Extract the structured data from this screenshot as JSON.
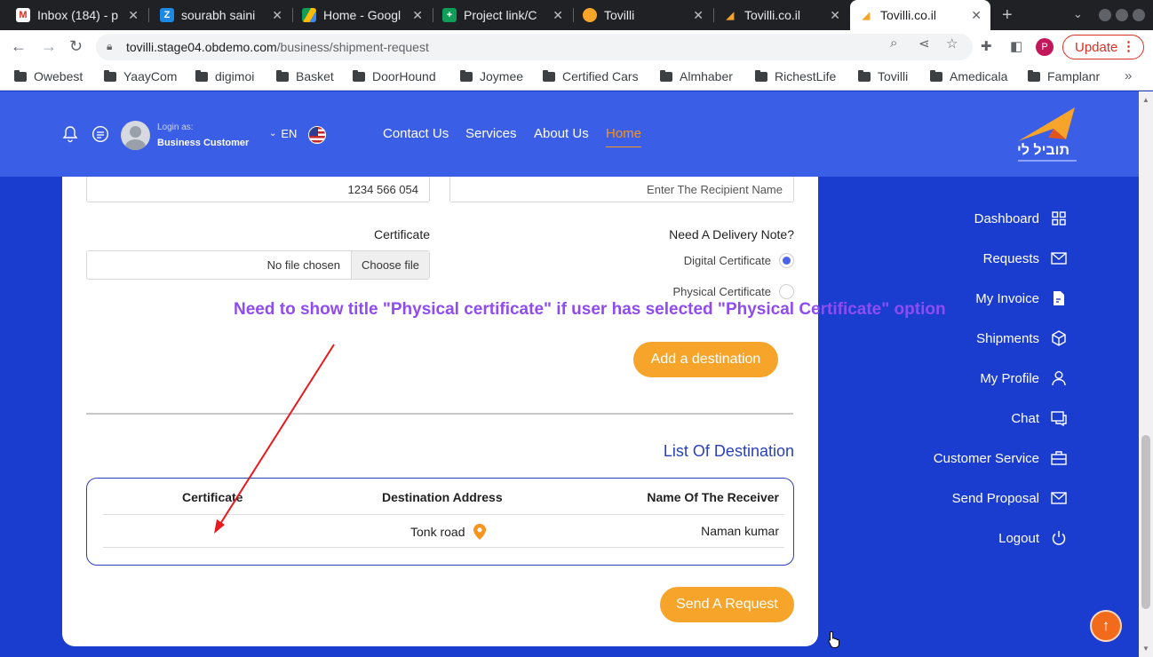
{
  "browser": {
    "tabs": [
      {
        "title": "Inbox (184) - p",
        "favicon": "gmail-icon"
      },
      {
        "title": "sourabh saini",
        "favicon": "zoho-icon"
      },
      {
        "title": "Home - Googl",
        "favicon": "google-drive-icon"
      },
      {
        "title": "Project link/C",
        "favicon": "google-sheets-icon"
      },
      {
        "title": "Tovilli",
        "favicon": "tovilli-icon"
      },
      {
        "title": "Tovilli.co.il",
        "favicon": "tovilli-logo-icon"
      },
      {
        "title": "Tovilli.co.il",
        "favicon": "tovilli-logo-icon",
        "active": true
      }
    ],
    "url_host": "tovilli.stage04.obdemo.com",
    "url_path": "/business/shipment-request",
    "profile_initial": "P",
    "update_label": "Update",
    "bookmarks": [
      "Owebest",
      "YaayCom",
      "digimoi",
      "Basket",
      "DoorHound",
      "Joymee",
      "Certified Cars",
      "Almhaber",
      "RichestLife",
      "Tovilli",
      "Amedicala",
      "Famplanr"
    ]
  },
  "header": {
    "login_as": "Login as:",
    "user_type": "Business Customer",
    "language": "EN",
    "nav": [
      "Contact Us",
      "Services",
      "About Us",
      "Home"
    ],
    "active_nav": "Home",
    "logo_text": "תוביל לי"
  },
  "form": {
    "phone_value": "1234 566 054",
    "recipient_placeholder": "Enter The Recipient Name",
    "certificate_label": "Certificate",
    "file_status": "No file chosen",
    "choose_file_label": "Choose file",
    "delivery_note_label": "Need A Delivery Note?",
    "delivery_options": [
      {
        "label": "Digital Certificate",
        "checked": true
      },
      {
        "label": "Physical Certificate",
        "checked": false
      }
    ],
    "add_destination_label": "Add a destination"
  },
  "destinations": {
    "title": "List Of Destination",
    "columns": [
      "Certificate",
      "Destination Address",
      "Name Of The Receiver"
    ],
    "rows": [
      {
        "certificate": "",
        "address": "Tonk road",
        "receiver": "Naman kumar"
      }
    ]
  },
  "send_request_label": "Send A Request",
  "sidebar": {
    "items": [
      {
        "label": "Dashboard",
        "icon": "grid-icon"
      },
      {
        "label": "Requests",
        "icon": "mail-icon"
      },
      {
        "label": "My Invoice",
        "icon": "invoice-icon"
      },
      {
        "label": "Shipments",
        "icon": "box-icon"
      },
      {
        "label": "My Profile",
        "icon": "user-icon"
      },
      {
        "label": "Chat",
        "icon": "chat-icon"
      },
      {
        "label": "Customer Service",
        "icon": "briefcase-icon"
      },
      {
        "label": "Send Proposal",
        "icon": "send-mail-icon"
      },
      {
        "label": "Logout",
        "icon": "power-icon"
      }
    ]
  },
  "annotation": "Need to show title \"Physical certificate\" if user has selected \"Physical Certificate\" option",
  "colors": {
    "header_bg": "#3a5ee5",
    "page_bg": "#1a3ccf",
    "accent_orange": "#f7a52a",
    "annotation_purple": "#8f4cf0",
    "arrow_red": "#e8191f"
  }
}
